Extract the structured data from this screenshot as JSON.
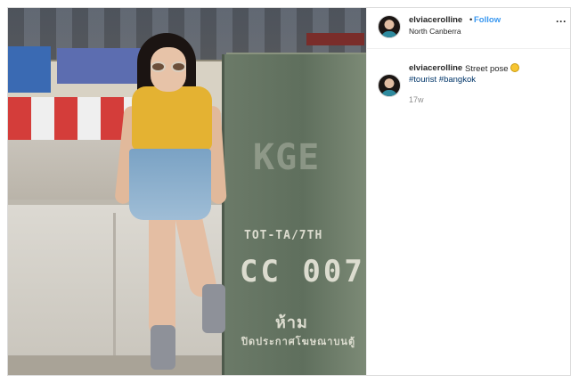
{
  "post": {
    "username": "elviacerolline",
    "separator": "•",
    "follow_label": "Follow",
    "location": "North Canberra",
    "more_icon": "more-options-icon",
    "more_glyph": "···"
  },
  "photo": {
    "cabinet_text_line1": "TOT-TA/7TH",
    "cabinet_text_line2": "CC 007",
    "cabinet_text_line3": "ห้าม",
    "cabinet_text_line4": "ปิดประกาศโฆษณาบนตู้",
    "cabinet_text_faded": "KGE"
  },
  "caption": {
    "username": "elviacerolline",
    "text": "Street pose",
    "emoji_icon": "smiling-face-emoji-icon",
    "hashtags": [
      "#tourist",
      "#bangkok"
    ],
    "timestamp": "17w"
  },
  "colors": {
    "link_blue": "#3897f0",
    "hashtag_blue": "#003569",
    "muted_gray": "#8e8e8e",
    "border": "#dbdbdb"
  }
}
